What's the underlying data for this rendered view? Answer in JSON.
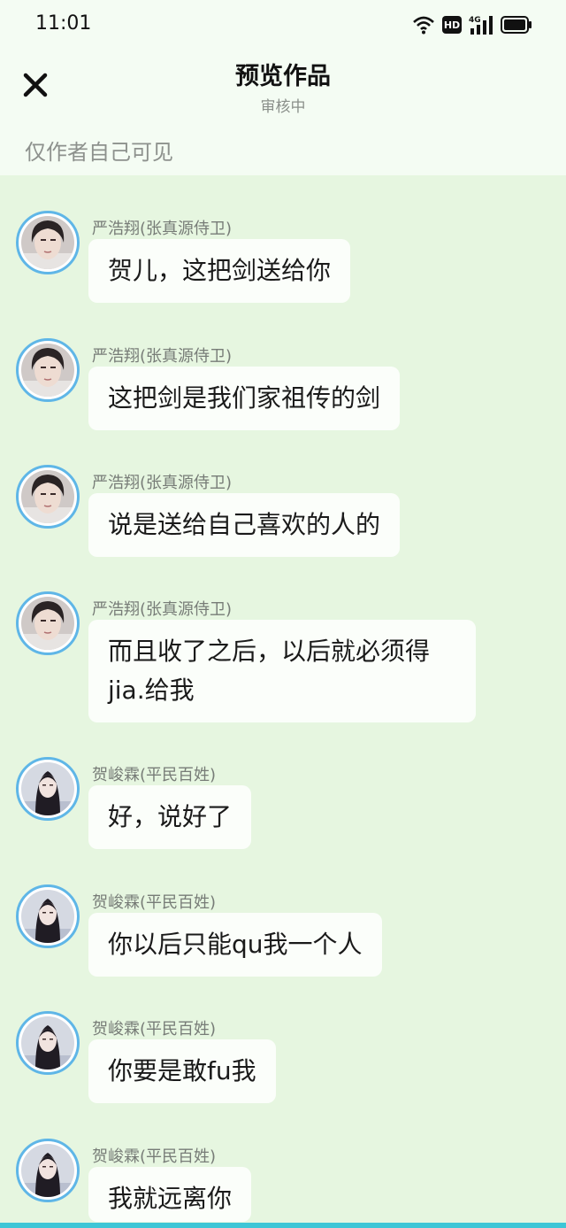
{
  "status_bar": {
    "time": "11:01",
    "hd_label": "HD",
    "network_label": "4G"
  },
  "header": {
    "title": "预览作品",
    "subtitle": "审核中",
    "visibility_note": "仅作者自己可见"
  },
  "messages": [
    {
      "name": "严浩翔(张真源侍卫)",
      "text": "贺儿，这把剑送给你",
      "avatar": "male"
    },
    {
      "name": "严浩翔(张真源侍卫)",
      "text": "这把剑是我们家祖传的剑",
      "avatar": "male"
    },
    {
      "name": "严浩翔(张真源侍卫)",
      "text": "说是送给自己喜欢的人的",
      "avatar": "male"
    },
    {
      "name": "严浩翔(张真源侍卫)",
      "text": "而且收了之后，以后就必须得jia.给我",
      "avatar": "male"
    },
    {
      "name": "贺峻霖(平民百姓)",
      "text": "好，说好了",
      "avatar": "female"
    },
    {
      "name": "贺峻霖(平民百姓)",
      "text": "你以后只能qu我一个人",
      "avatar": "female"
    },
    {
      "name": "贺峻霖(平民百姓)",
      "text": "你要是敢fu我",
      "avatar": "female"
    },
    {
      "name": "贺峻霖(平民百姓)",
      "text": "我就远离你",
      "avatar": "female"
    }
  ],
  "colors": {
    "chat_bg": "#e6f6e0",
    "header_bg": "#f4fcf3",
    "avatar_ring": "#5fb6e7",
    "bubble": "#fbfefa"
  }
}
